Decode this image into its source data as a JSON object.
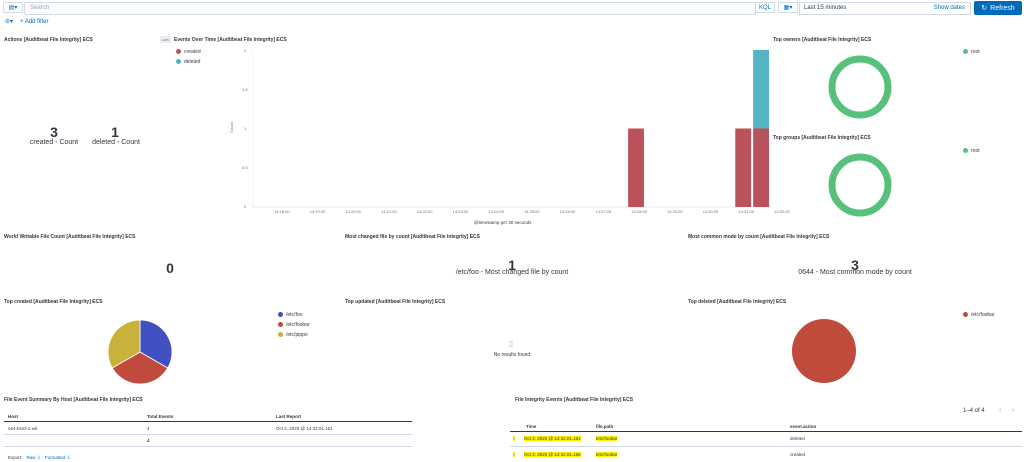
{
  "query_bar": {
    "search_placeholder": "Search",
    "language": "KQL",
    "time_range": "Last 15 minutes",
    "show_dates": "Show dates",
    "refresh": "Refresh",
    "add_filter": "+ Add filter"
  },
  "actions": {
    "title": "Actions [Auditbeat File Integrity] ECS",
    "metrics": [
      {
        "value": "3",
        "label": "created - Count"
      },
      {
        "value": "1",
        "label": "deleted - Count"
      }
    ]
  },
  "events_over_time": {
    "title": "Events Over Time [Auditbeat File Integrity] ECS",
    "toggle_label": "AXIS",
    "legend": [
      {
        "name": "created",
        "color": "#b9525a"
      },
      {
        "name": "deleted",
        "color": "#54b4c4"
      }
    ],
    "ylabel": "Count",
    "xlabel": "@timestamp per 30 seconds",
    "yticks": [
      "2",
      "1.5",
      "1",
      "0.5",
      "0"
    ],
    "xticks": [
      "14:18:00",
      "14:19:00",
      "14:20:00",
      "14:21:00",
      "14:22:00",
      "14:23:00",
      "14:24:00",
      "14:25:00",
      "14:26:00",
      "14:27:00",
      "14:28:00",
      "14:29:00",
      "14:30:00",
      "14:31:00",
      "14:32:00"
    ]
  },
  "chart_data": {
    "type": "bar",
    "xlabel": "@timestamp per 30 seconds",
    "ylabel": "Count",
    "ylim": [
      0,
      2
    ],
    "x_domain": [
      "14:18:00",
      "14:32:30"
    ],
    "series": [
      {
        "name": "created",
        "color": "#b9525a",
        "points": [
          [
            "14:28:30",
            1
          ],
          [
            "14:31:30",
            1
          ],
          [
            "14:32:00",
            1
          ]
        ]
      },
      {
        "name": "deleted",
        "color": "#54b4c4",
        "points": [
          [
            "14:32:00",
            1
          ]
        ]
      }
    ]
  },
  "top_owners": {
    "title": "Top owners [Auditbeat File Integrity] ECS",
    "legend": "root",
    "color": "#57c17b"
  },
  "top_groups": {
    "title": "Top groups [Auditbeat File Integrity] ECS",
    "legend": "root",
    "color": "#57c17b"
  },
  "world_writable": {
    "title": "World Writable File Count [Auditbeat File Integrity] ECS",
    "value": "0"
  },
  "most_changed": {
    "title": "Most changed file by count [Auditbeat File Integrity] ECS",
    "value": "1",
    "label": "/etc/foo - Most changed file by count"
  },
  "most_common_mode": {
    "title": "Most common mode by count [Auditbeat File Integrity] ECS",
    "value": "3",
    "label": "0644 - Most common mode by count"
  },
  "top_created": {
    "title": "Top created [Auditbeat File Integrity] ECS",
    "slices": [
      {
        "name": "/etc/foo",
        "value": 1,
        "color": "#4050c0"
      },
      {
        "name": "/etc/foobar",
        "value": 1,
        "color": "#c04b3c"
      },
      {
        "name": "/etc/pippo",
        "value": 1,
        "color": "#c9b23c"
      }
    ]
  },
  "top_updated": {
    "title": "Top updated [Auditbeat File Integrity] ECS",
    "empty": "No results found"
  },
  "top_deleted": {
    "title": "Top deleted [Auditbeat File Integrity] ECS",
    "legend": "/etc/foobar",
    "color": "#c04b3c"
  },
  "summary": {
    "title": "File Event Summary By Host [Auditbeat File Integrity] ECS",
    "headers": [
      "Host",
      "Total Events",
      "Last Report"
    ],
    "rows": [
      [
        "ne4-bsml-2.wit",
        "4",
        "Oct 2, 2020 @ 14:32:01.161"
      ]
    ],
    "total": "4",
    "export_label": "Export:",
    "export_raw": "Raw",
    "export_formatted": "Formatted"
  },
  "events_table": {
    "title": "File Integrity Events [Auditbeat File Integrity] ECS",
    "pagination": "1–4 of 4",
    "headers": [
      "Time",
      "file.path",
      "event.action"
    ],
    "rows": [
      [
        "Oct 2, 2020 @ 14:32:01.161",
        "/etc/foobar",
        "deleted"
      ],
      [
        "Oct 2, 2020 @ 14:32:01.158",
        "/etc/foobar",
        "created"
      ]
    ]
  }
}
